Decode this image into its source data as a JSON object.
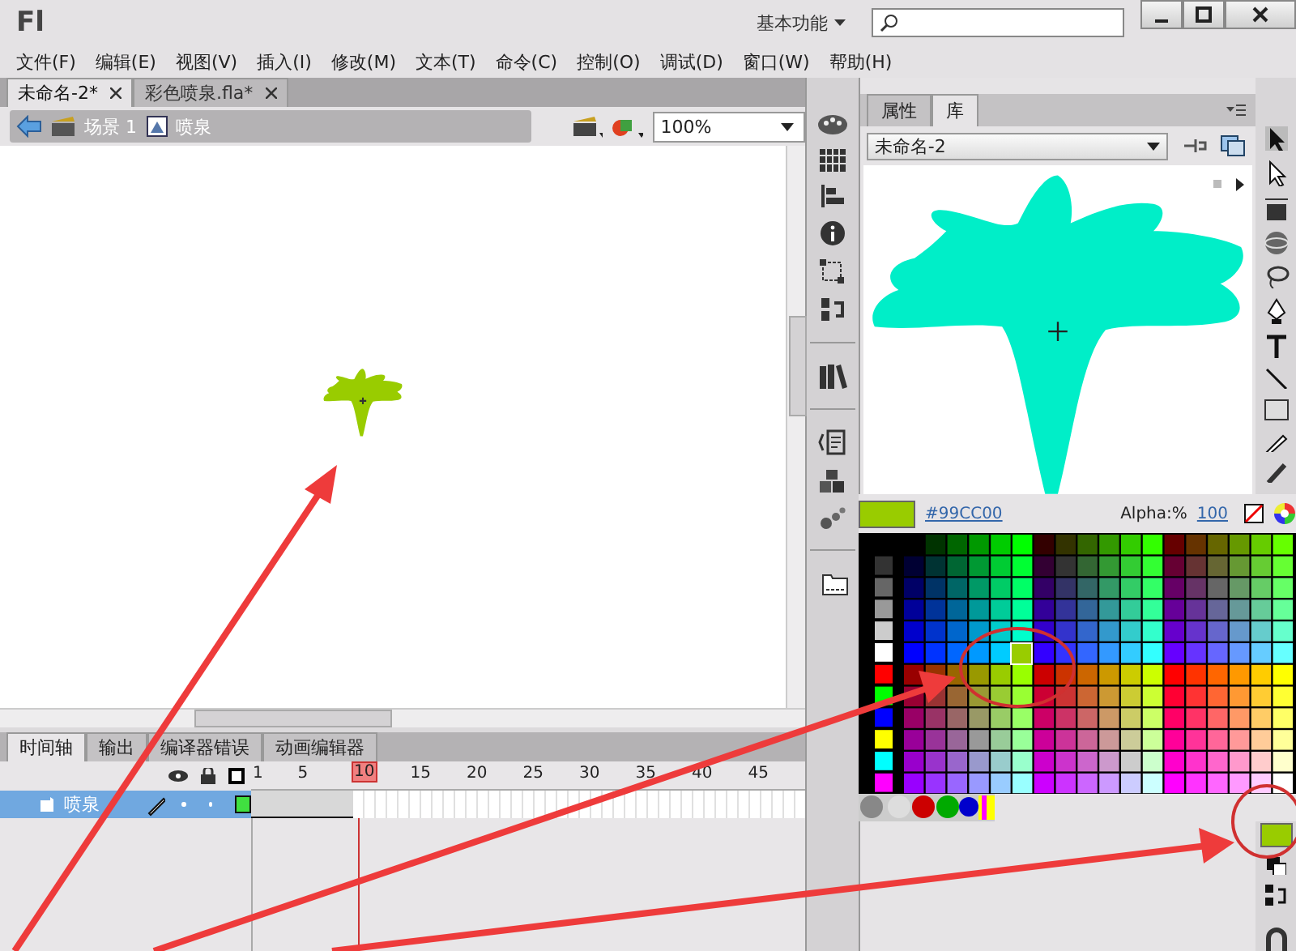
{
  "app": {
    "logo": "Fl",
    "workspace": "基本功能"
  },
  "menu": [
    "文件(F)",
    "编辑(E)",
    "视图(V)",
    "插入(I)",
    "修改(M)",
    "文本(T)",
    "命令(C)",
    "控制(O)",
    "调试(D)",
    "窗口(W)",
    "帮助(H)"
  ],
  "documents": [
    {
      "title": "未命名-2*",
      "selected": true
    },
    {
      "title": "彩色喷泉.fla*",
      "selected": false
    }
  ],
  "edit_bar": {
    "scene": "场景 1",
    "symbol": "喷泉",
    "zoom": "100%"
  },
  "timeline": {
    "tabs": [
      {
        "label": "时间轴",
        "selected": true
      },
      {
        "label": "输出",
        "selected": false
      },
      {
        "label": "编译器错误",
        "selected": false
      },
      {
        "label": "动画编辑器",
        "selected": false
      }
    ],
    "frame_numbers": [
      "1",
      "5",
      "10",
      "15",
      "20",
      "25",
      "30",
      "35",
      "40",
      "45"
    ],
    "layers": [
      {
        "name": "喷泉",
        "selected": true
      }
    ]
  },
  "panel": {
    "tabs": [
      {
        "label": "属性",
        "selected": false
      },
      {
        "label": "库",
        "selected": true
      }
    ],
    "library": "未命名-2"
  },
  "color": {
    "hex": "#99CC00",
    "alpha_label": "Alpha:%",
    "alpha": "100"
  }
}
